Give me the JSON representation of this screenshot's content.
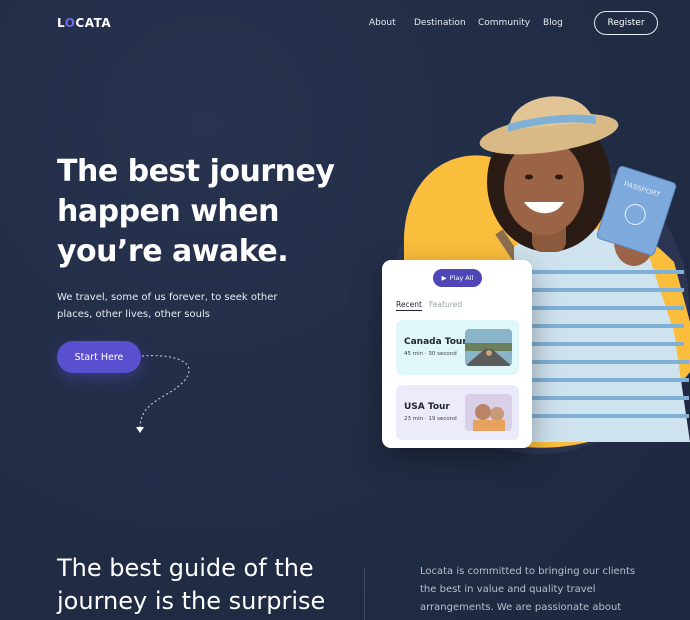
{
  "brand": {
    "logo_prefix": "L",
    "logo_accent": "O",
    "logo_suffix": "CATA",
    "accent_color": "#6b6cf0"
  },
  "nav": {
    "items": [
      "About",
      "Destination",
      "Community",
      "Blog"
    ],
    "register_label": "Register"
  },
  "hero": {
    "title_lines": [
      "The best journey",
      "happen when",
      "you’re awake."
    ],
    "subtitle": "We travel, some of us forever, to seek other places, other lives, other souls",
    "cta_label": "Start Here"
  },
  "card": {
    "play_all_label": "Play All",
    "tabs": [
      "Recent",
      "Featured"
    ],
    "tours": [
      {
        "name": "Canada Tour",
        "meta": "45 min · 30 second"
      },
      {
        "name": "USA Tour",
        "meta": "23 min · 19 second"
      }
    ]
  },
  "guide": {
    "title_lines": [
      "The best guide of the",
      "journey is the surprise"
    ],
    "text": "Locata is committed to bringing our clients the best in value and quality travel arrangements. We are passionate about"
  },
  "colors": {
    "background": "#212c45",
    "primary_button": "#5a4fcf",
    "blob_yellow": "#fbbd3c"
  },
  "icons": [
    "play-icon",
    "arrow-down-icon",
    "passport-icon"
  ]
}
